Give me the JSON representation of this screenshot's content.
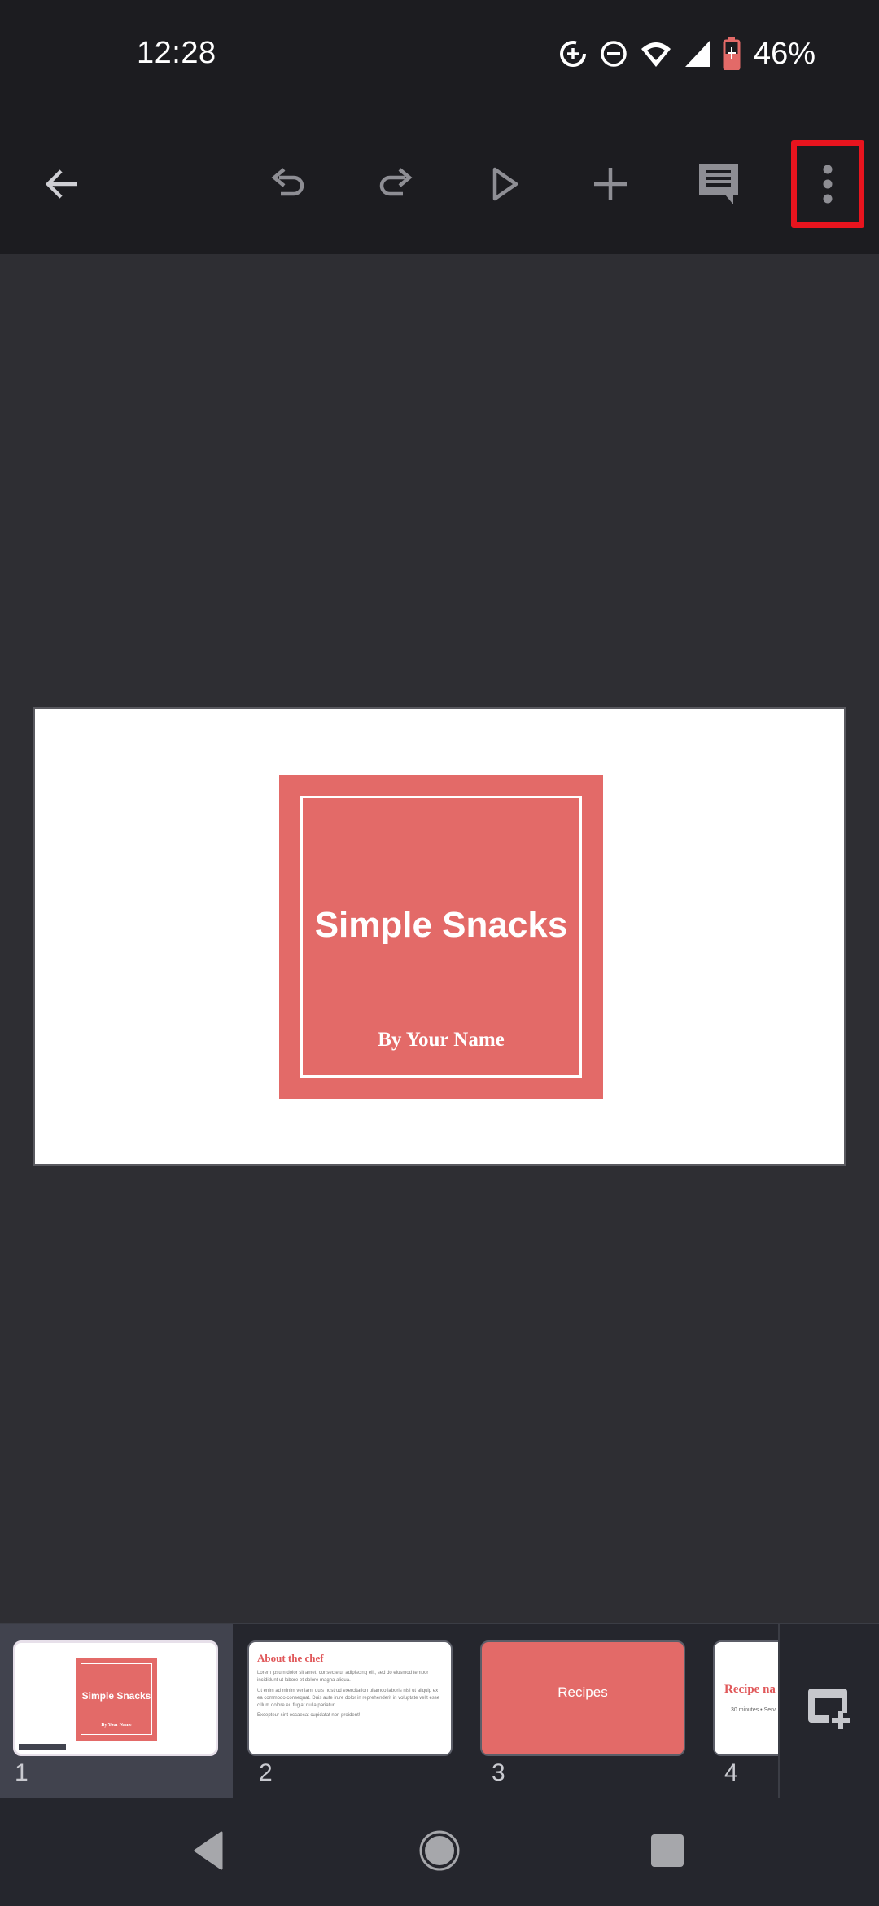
{
  "status_bar": {
    "time": "12:28",
    "icons": [
      "data-saver-icon",
      "do-not-disturb-icon",
      "wifi-icon",
      "cell-signal-icon",
      "battery-charging-icon"
    ],
    "battery_percent": "46%",
    "battery_color": "#e36a68"
  },
  "toolbar": {
    "buttons": [
      {
        "name": "back-button",
        "icon": "arrow-left-icon"
      },
      {
        "name": "undo-button",
        "icon": "undo-icon"
      },
      {
        "name": "redo-button",
        "icon": "redo-icon"
      },
      {
        "name": "present-button",
        "icon": "play-icon"
      },
      {
        "name": "insert-button",
        "icon": "plus-icon"
      },
      {
        "name": "comments-button",
        "icon": "comment-icon"
      },
      {
        "name": "more-options-button",
        "icon": "more-vert-icon"
      }
    ],
    "highlighted": "more-options-button",
    "highlight_color": "#e8141e"
  },
  "current_slide": {
    "title": "Simple Snacks",
    "subtitle": "By Your Name",
    "accent_color": "#e36a68"
  },
  "filmstrip": {
    "selected_index": 1,
    "slides": [
      {
        "number": "1",
        "title": "Simple Snacks",
        "subtitle": "By Your Name"
      },
      {
        "number": "2",
        "title": "About the chef",
        "paragraphs": [
          "Lorem ipsum dolor sit amet, consectetur adipiscing elit, sed do eiusmod tempor incididunt ut labore et dolore magna aliqua.",
          "Ut enim ad minim veniam, quis nostrud exercitation ullamco laboris nisi ut aliquip ex ea commodo consequat. Duis aute irure dolor in reprehenderit in voluptate velit esse cillum dolore eu fugiat nulla pariatur.",
          "Excepteur sint occaecat cupidatat non proident!"
        ]
      },
      {
        "number": "3",
        "title": "Recipes"
      },
      {
        "number": "4",
        "title": "Recipe na",
        "meta": "30 minutes • Serv"
      }
    ],
    "add_slide_icon": "add-slide-icon"
  },
  "nav_bar": {
    "buttons": [
      "back-nav-icon",
      "home-nav-icon",
      "recents-nav-icon"
    ]
  }
}
